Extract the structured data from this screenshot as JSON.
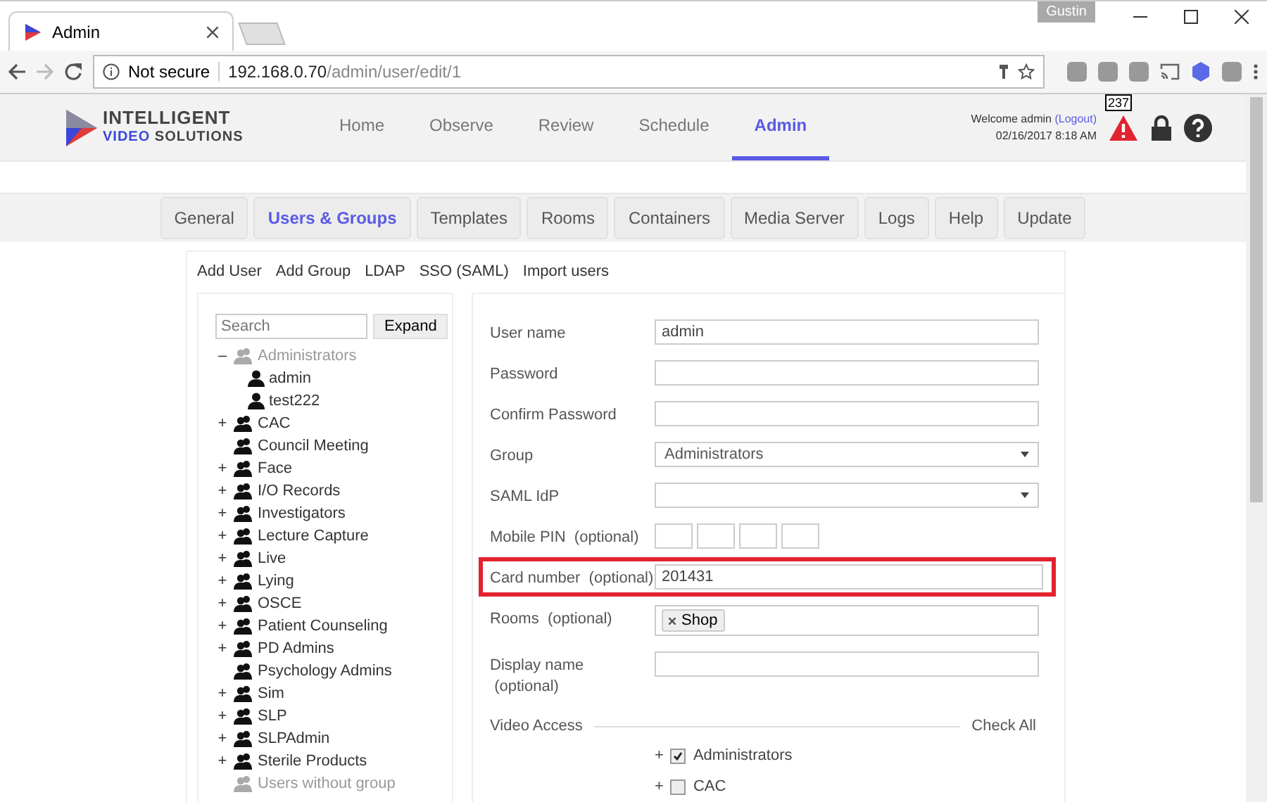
{
  "browser": {
    "tab_title": "Admin",
    "profile": "Gustin",
    "security": "Not secure",
    "url_host": "192.168.0.70",
    "url_path": "/admin/user/edit/1"
  },
  "header": {
    "logo_line1": "INTELLIGENT",
    "logo_line2_a": "VIDEO",
    "logo_line2_b": "SOLUTIONS",
    "nav": [
      {
        "label": "Home",
        "selected": false
      },
      {
        "label": "Observe",
        "selected": false
      },
      {
        "label": "Review",
        "selected": false
      },
      {
        "label": "Schedule",
        "selected": false
      },
      {
        "label": "Admin",
        "selected": true
      }
    ],
    "welcome": "Welcome admin",
    "logout": "(Logout)",
    "datetime": "02/16/2017 8:18 AM",
    "alert_count": "237"
  },
  "admin_tabs": [
    {
      "label": "General",
      "selected": false
    },
    {
      "label": "Users & Groups",
      "selected": true
    },
    {
      "label": "Templates",
      "selected": false
    },
    {
      "label": "Rooms",
      "selected": false
    },
    {
      "label": "Containers",
      "selected": false
    },
    {
      "label": "Media Server",
      "selected": false
    },
    {
      "label": "Logs",
      "selected": false
    },
    {
      "label": "Help",
      "selected": false
    },
    {
      "label": "Update",
      "selected": false
    }
  ],
  "sub_links": [
    "Add User",
    "Add Group",
    "LDAP",
    "SSO (SAML)",
    "Import users"
  ],
  "tree": {
    "search_placeholder": "Search",
    "expand_button": "Expand",
    "items": [
      {
        "toggle": "–",
        "label": "Administrators",
        "disabled": true,
        "children": [
          {
            "label": "admin"
          },
          {
            "label": "test222"
          }
        ]
      },
      {
        "toggle": "+",
        "label": "CAC",
        "disabled": false
      },
      {
        "label": "Council Meeting",
        "disabled": false
      },
      {
        "toggle": "+",
        "label": "Face",
        "disabled": false
      },
      {
        "toggle": "+",
        "label": "I/O Records",
        "disabled": false
      },
      {
        "toggle": "+",
        "label": "Investigators",
        "disabled": false
      },
      {
        "toggle": "+",
        "label": "Lecture Capture",
        "disabled": false
      },
      {
        "toggle": "+",
        "label": "Live",
        "disabled": false
      },
      {
        "toggle": "+",
        "label": "Lying",
        "disabled": false
      },
      {
        "toggle": "+",
        "label": "OSCE",
        "disabled": false
      },
      {
        "toggle": "+",
        "label": "Patient Counseling",
        "disabled": false
      },
      {
        "toggle": "+",
        "label": "PD Admins",
        "disabled": false
      },
      {
        "label": "Psychology Admins",
        "disabled": false
      },
      {
        "toggle": "+",
        "label": "Sim",
        "disabled": false
      },
      {
        "toggle": "+",
        "label": "SLP",
        "disabled": false
      },
      {
        "toggle": "+",
        "label": "SLPAdmin",
        "disabled": false
      },
      {
        "toggle": "+",
        "label": "Sterile Products",
        "disabled": false
      },
      {
        "label": "Users without group",
        "disabled": true
      }
    ]
  },
  "form": {
    "fields": [
      {
        "kind": "text",
        "label": "User name",
        "value": "admin",
        "highlighted": false
      },
      {
        "kind": "text",
        "label": "Password",
        "highlighted": false
      },
      {
        "kind": "text",
        "label": "Confirm Password",
        "highlighted": false
      },
      {
        "kind": "select",
        "label": "Group",
        "value": "Administrators",
        "highlighted": false
      },
      {
        "kind": "select",
        "label": "SAML IdP",
        "highlighted": false
      },
      {
        "kind": "pin",
        "label": "Mobile PIN  (optional)",
        "highlighted": false
      },
      {
        "kind": "text",
        "label": "Card number  (optional)",
        "value": "201431",
        "highlighted": true
      },
      {
        "kind": "tags",
        "label": "Rooms  (optional)",
        "tags": [
          "Shop"
        ],
        "highlighted": false
      },
      {
        "kind": "text",
        "label": "Display name\n (optional)",
        "highlighted": false
      }
    ],
    "video_access": {
      "title": "Video Access",
      "check_all": "Check All",
      "groups": [
        {
          "toggle": "+",
          "label": "Administrators",
          "checked": true
        },
        {
          "toggle": "+",
          "label": "CAC",
          "checked": false
        }
      ]
    }
  }
}
